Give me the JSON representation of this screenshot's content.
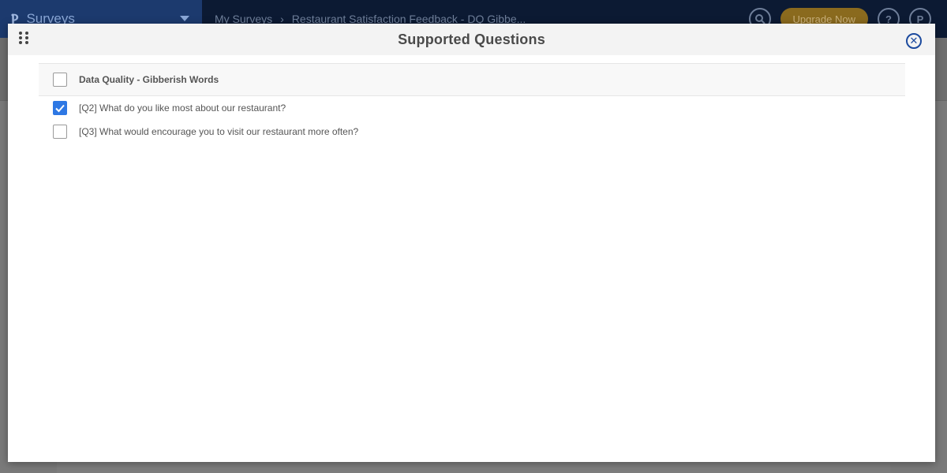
{
  "app": {
    "brand": "Surveys",
    "breadcrumb": [
      "My Surveys",
      "Restaurant Satisfaction Feedback - DQ Gibbe..."
    ],
    "upgrade_label": "Upgrade Now",
    "help_label": "?",
    "profile_initial": "P"
  },
  "modal": {
    "title": "Supported Questions",
    "header_row": {
      "label": "Data Quality - Gibberish Words",
      "checked": false
    },
    "questions": [
      {
        "label": "[Q2] What do you like most about our restaurant?",
        "checked": true
      },
      {
        "label": "[Q3] What would encourage you to visit our restaurant more often?",
        "checked": false
      }
    ]
  },
  "colors": {
    "accent": "#2e78e4",
    "close_icon": "#1c4a9e",
    "topbar": "#0c1a33"
  }
}
